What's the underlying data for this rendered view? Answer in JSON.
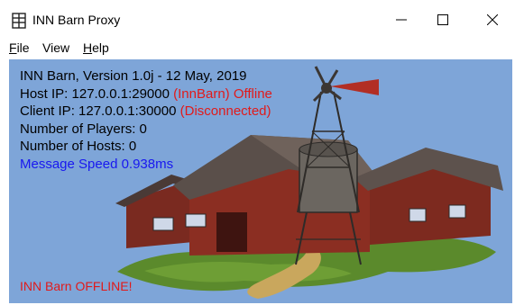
{
  "window": {
    "title": "INN Barn Proxy"
  },
  "menu": {
    "file": "File",
    "view": "View",
    "help": "Help"
  },
  "info": {
    "version": "INN Barn, Version 1.0j - 12 May, 2019",
    "host_prefix": "Host IP: 127.0.0.1:29000 ",
    "host_status": "(InnBarn) Offline",
    "client_prefix": "Client IP: 127.0.0.1:30000 ",
    "client_status": "(Disconnected)",
    "players": "Number of Players: 0",
    "hosts": "Number of Hosts: 0",
    "speed": "Message Speed  0.938ms"
  },
  "status": "INN Barn OFFLINE!",
  "colors": {
    "background": "#7ea5d8",
    "error": "#e11a1a",
    "speed": "#1818f0"
  },
  "icons": [
    "app-icon",
    "minimize-icon",
    "maximize-icon",
    "close-icon",
    "barn-windmill-illustration"
  ]
}
